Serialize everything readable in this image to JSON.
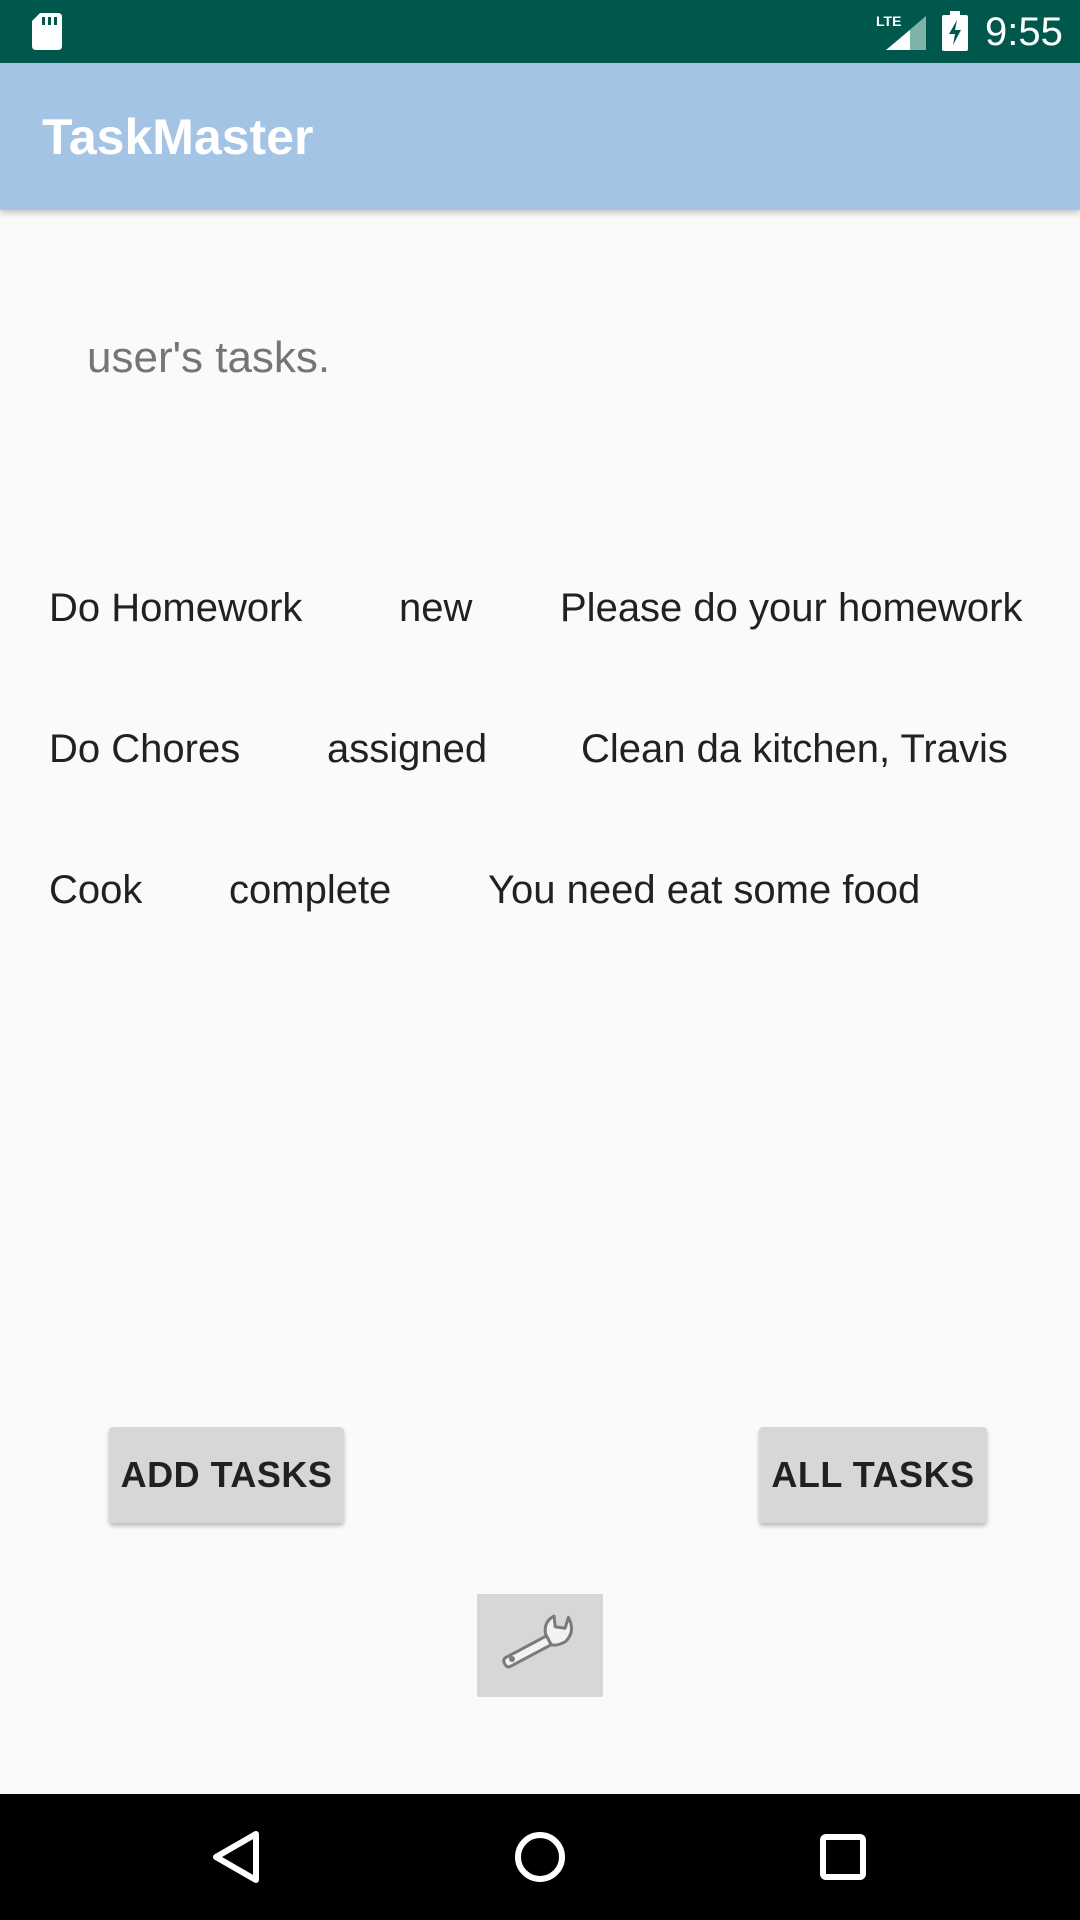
{
  "status_bar": {
    "time": "9:55",
    "network_label": "LTE",
    "icons": [
      "sd-card-icon",
      "lte-signal-icon",
      "battery-charging-icon"
    ]
  },
  "app_bar": {
    "title": "TaskMaster",
    "color": "#a4c4e6"
  },
  "main": {
    "subtitle": "user's tasks.",
    "tasks": [
      {
        "title": "Do Homework",
        "state": "new",
        "body": "Please do your homework"
      },
      {
        "title": "Do Chores",
        "state": "assigned",
        "body": "Clean da kitchen, Travis"
      },
      {
        "title": "Cook",
        "state": "complete",
        "body": "You need eat some food"
      }
    ]
  },
  "buttons": {
    "add_tasks": "ADD TASKS",
    "all_tasks": "ALL TASKS",
    "settings_icon": "wrench-icon"
  },
  "nav_bar": {
    "icons": [
      "back-icon",
      "home-icon",
      "recents-icon"
    ]
  },
  "colors": {
    "status_bar": "#00574b",
    "background": "#fafafa",
    "button": "#d6d7d7",
    "nav_bar": "#000000"
  }
}
